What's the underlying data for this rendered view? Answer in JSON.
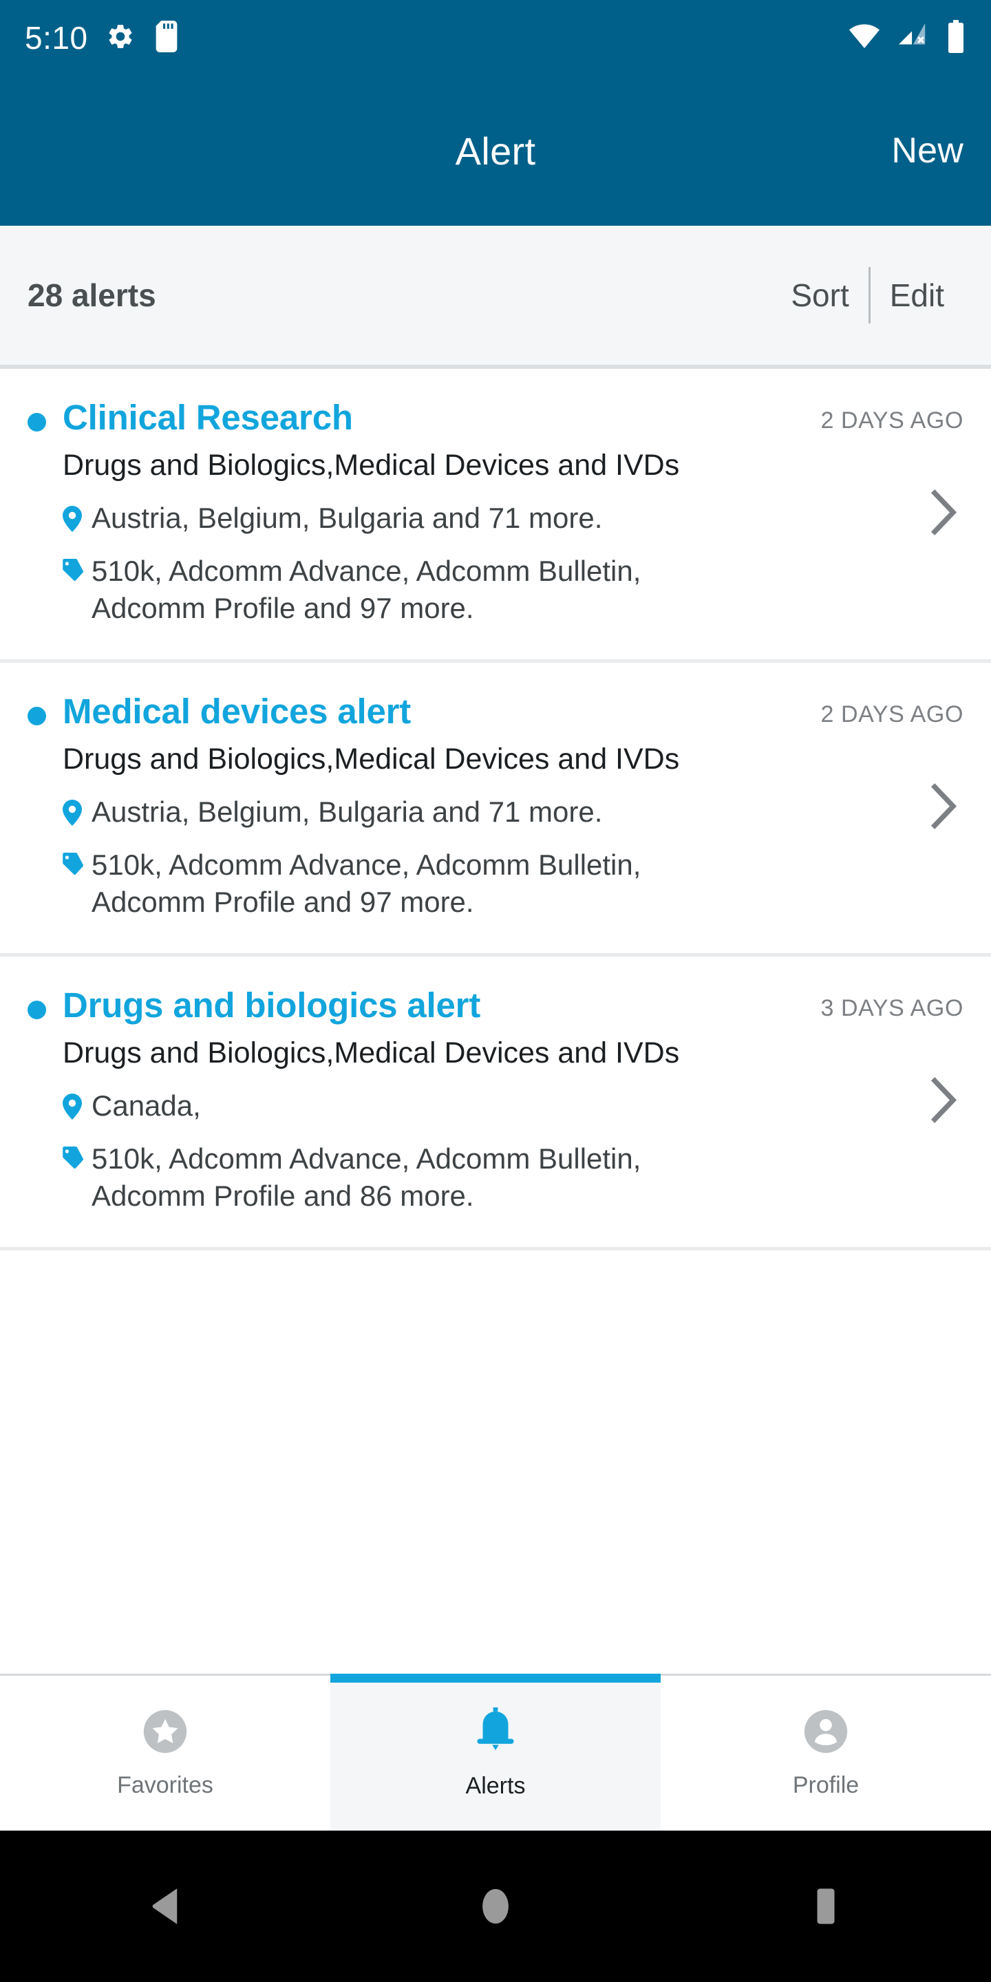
{
  "status_bar": {
    "clock": "5:10",
    "icons": [
      "gear-icon",
      "sd-card-icon",
      "wifi-icon",
      "cellular-no-sim-icon",
      "battery-icon"
    ]
  },
  "header": {
    "title": "Alert",
    "action_label": "New",
    "background_color": "#006089"
  },
  "sort_bar": {
    "count_label": "28 alerts",
    "sort_label": "Sort",
    "edit_label": "Edit"
  },
  "accent_color": "#12a5dd",
  "alerts": [
    {
      "title": "Clinical Research",
      "age": "2 DAYS AGO",
      "subtitle": "Drugs and Biologics,Medical Devices and IVDs",
      "locations": "Austria, Belgium, Bulgaria and 71 more.",
      "tags": "510k, Adcomm Advance, Adcomm Bulletin, Adcomm Profile and 97 more."
    },
    {
      "title": "Medical devices alert",
      "age": "2 DAYS AGO",
      "subtitle": "Drugs and Biologics,Medical Devices and IVDs",
      "locations": "Austria, Belgium, Bulgaria and 71 more.",
      "tags": "510k, Adcomm Advance, Adcomm Bulletin, Adcomm Profile and 97 more."
    },
    {
      "title": "Drugs and biologics alert",
      "age": "3 DAYS AGO",
      "subtitle": "Drugs and Biologics,Medical Devices and IVDs",
      "locations": "Canada,",
      "tags": "510k, Adcomm Advance, Adcomm Bulletin, Adcomm Profile and 86 more."
    }
  ],
  "tab_bar": {
    "tabs": [
      {
        "label": "Favorites",
        "icon": "star-circle-icon",
        "active": false
      },
      {
        "label": "Alerts",
        "icon": "bell-icon",
        "active": true
      },
      {
        "label": "Profile",
        "icon": "person-circle-icon",
        "active": false
      }
    ]
  },
  "nav_bar": {
    "back": "back-triangle-icon",
    "home": "home-circle-icon",
    "recents": "recents-square-icon"
  }
}
